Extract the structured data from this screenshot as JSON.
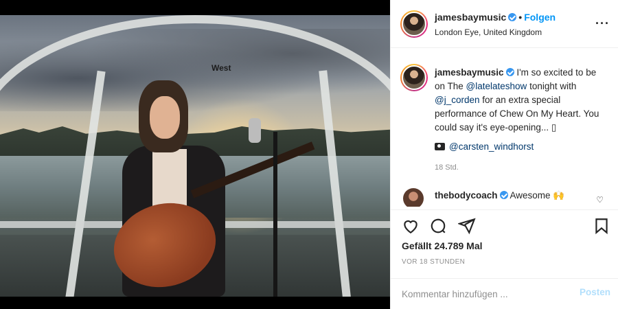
{
  "post": {
    "photo_alt": "Man with guitar in London Eye capsule",
    "sign_text": "West"
  },
  "header": {
    "username": "jamesbaymusic",
    "follow_label": "Folgen",
    "location": "London Eye, United Kingdom",
    "more_icon": "more-icon"
  },
  "caption": {
    "username": "jamesbaymusic",
    "text_1": "I'm so excited to be on The ",
    "mention_1": "@latelateshow",
    "text_2": " tonight with ",
    "mention_2": "@j_corden",
    "text_3": " for an extra special performance of Chew On My Heart. You could say it's eye-opening... ▯",
    "credit_mention": "@carsten_windhorst",
    "age": "18 Std."
  },
  "comment": {
    "username": "thebodycoach",
    "text": "Awesome 🙌"
  },
  "actions": {
    "likes": "Gefällt 24.789 Mal",
    "timestamp": "VOR 18 STUNDEN"
  },
  "add_comment": {
    "placeholder": "Kommentar hinzufügen ...",
    "post_label": "Posten"
  },
  "colors": {
    "accent": "#0095f6",
    "verified": "#3897f0",
    "muted": "#8e8e8e"
  }
}
